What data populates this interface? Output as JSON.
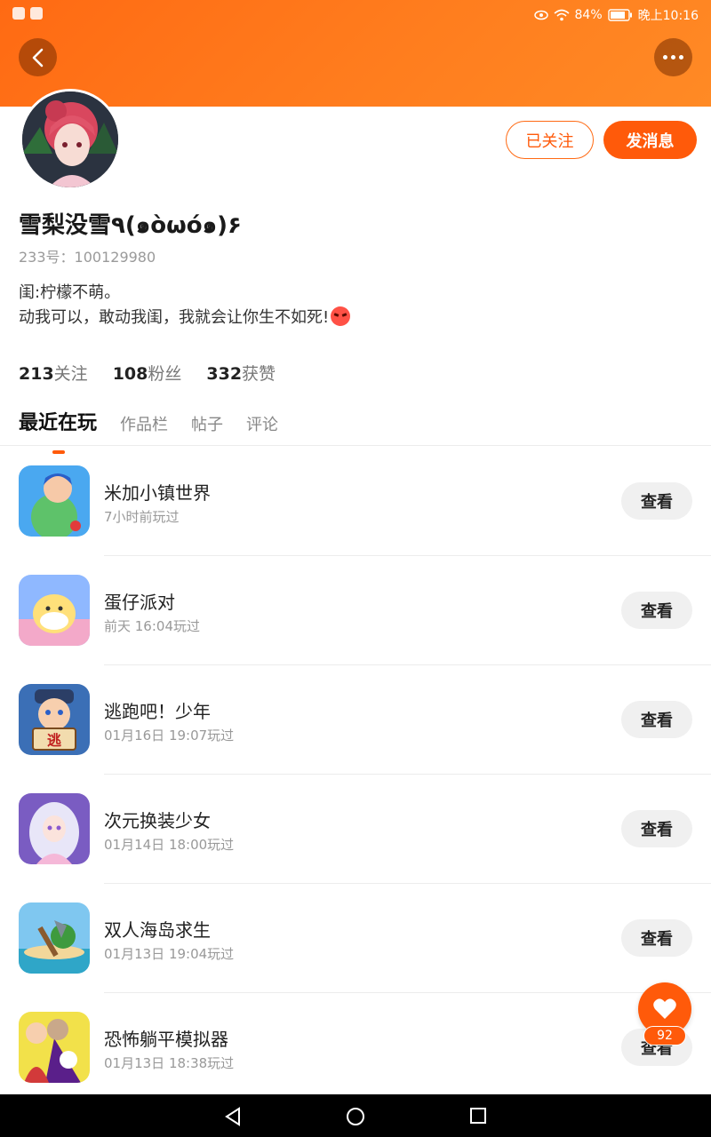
{
  "status": {
    "battery_percent": "84%",
    "time": "晚上10:16"
  },
  "profile": {
    "username": "雪梨没雪٩(๑òωó๑)۶",
    "user_id": "233号：100129980",
    "bio_line1": "闺:柠檬不萌。",
    "bio_line2": "动我可以，敢动我闺，我就会让你生不如死!",
    "following_button": "已关注",
    "message_button": "发消息"
  },
  "stats": [
    {
      "value": "213",
      "label": "关注"
    },
    {
      "value": "108",
      "label": "粉丝"
    },
    {
      "value": "332",
      "label": "获赞"
    }
  ],
  "tabs": [
    "最近在玩",
    "作品栏",
    "帖子",
    "评论"
  ],
  "games": [
    {
      "name": "米加小镇世界",
      "time": "7小时前玩过",
      "button": "查看"
    },
    {
      "name": "蛋仔派对",
      "time": "前天 16:04玩过",
      "button": "查看"
    },
    {
      "name": "逃跑吧！少年",
      "time": "01月16日 19:07玩过",
      "button": "查看",
      "icon_text": "逃"
    },
    {
      "name": "次元换装少女",
      "time": "01月14日 18:00玩过",
      "button": "查看"
    },
    {
      "name": "双人海岛求生",
      "time": "01月13日 19:04玩过",
      "button": "查看"
    },
    {
      "name": "恐怖躺平模拟器",
      "time": "01月13日 18:38玩过",
      "button": "查看"
    }
  ],
  "like_count": "92",
  "colors": {
    "accent": "#ff5a0a",
    "header_gradient_start": "#ff6a13",
    "header_gradient_end": "#ff8a25"
  }
}
